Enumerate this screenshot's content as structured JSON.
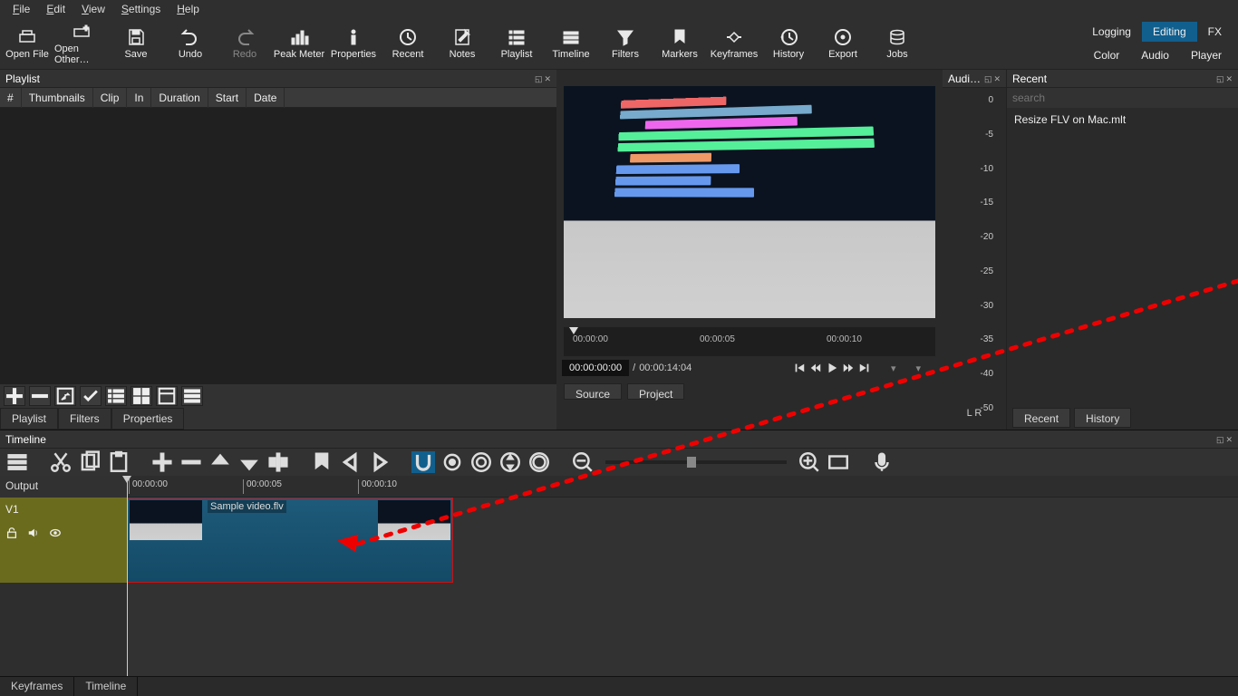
{
  "menu": [
    "File",
    "Edit",
    "View",
    "Settings",
    "Help"
  ],
  "toolbar": [
    {
      "name": "open-file",
      "label": "Open File",
      "icon": "drawer"
    },
    {
      "name": "open-other",
      "label": "Open Other…",
      "icon": "drawer-plus"
    },
    {
      "name": "save",
      "label": "Save",
      "icon": "floppy"
    },
    {
      "name": "undo",
      "label": "Undo",
      "icon": "undo"
    },
    {
      "name": "redo",
      "label": "Redo",
      "icon": "redo",
      "disabled": true
    },
    {
      "name": "peak-meter",
      "label": "Peak Meter",
      "icon": "bars"
    },
    {
      "name": "properties",
      "label": "Properties",
      "icon": "info"
    },
    {
      "name": "recent",
      "label": "Recent",
      "icon": "clock"
    },
    {
      "name": "notes",
      "label": "Notes",
      "icon": "note"
    },
    {
      "name": "playlist-tb",
      "label": "Playlist",
      "icon": "list"
    },
    {
      "name": "timeline-tb",
      "label": "Timeline",
      "icon": "timeline"
    },
    {
      "name": "filters",
      "label": "Filters",
      "icon": "funnel"
    },
    {
      "name": "markers",
      "label": "Markers",
      "icon": "marker"
    },
    {
      "name": "keyframes",
      "label": "Keyframes",
      "icon": "keyframes"
    },
    {
      "name": "history",
      "label": "History",
      "icon": "history"
    },
    {
      "name": "export",
      "label": "Export",
      "icon": "disc"
    },
    {
      "name": "jobs",
      "label": "Jobs",
      "icon": "stack"
    }
  ],
  "right_tabs": {
    "row1": [
      "Logging",
      "Editing",
      "FX"
    ],
    "active1": "Editing",
    "row2": [
      "Color",
      "Audio",
      "Player"
    ]
  },
  "playlist": {
    "title": "Playlist",
    "columns": [
      "#",
      "Thumbnails",
      "Clip",
      "In",
      "Duration",
      "Start",
      "Date"
    ],
    "bottom_tabs": [
      "Playlist",
      "Filters",
      "Properties"
    ]
  },
  "preview": {
    "ruler": [
      "00:00:00",
      "00:00:05",
      "00:00:10"
    ],
    "time_current": "00:00:00:00",
    "time_total": "00:00:14:04",
    "src_tabs": [
      "Source",
      "Project"
    ]
  },
  "audio_meter": {
    "title": "Audi…",
    "ticks": [
      "0",
      "-5",
      "-10",
      "-15",
      "-20",
      "-25",
      "-30",
      "-35",
      "-40",
      "-50"
    ],
    "lr": "L   R"
  },
  "recent": {
    "title": "Recent",
    "search_ph": "search",
    "items": [
      "Resize FLV on Mac.mlt"
    ],
    "btns": [
      "Recent",
      "History"
    ]
  },
  "timeline": {
    "title": "Timeline",
    "output": "Output",
    "track": "V1",
    "ruler": [
      "00:00:00",
      "00:00:05",
      "00:00:10"
    ],
    "clip_label": "Sample video.flv",
    "bottom_tabs": [
      "Keyframes",
      "Timeline"
    ]
  }
}
